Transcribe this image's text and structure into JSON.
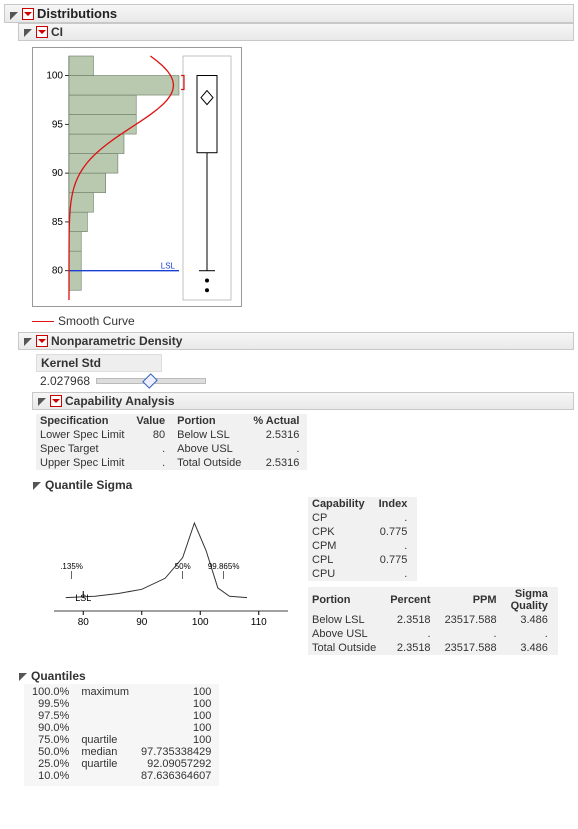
{
  "title": "Distributions",
  "section_ci": "CI",
  "legend_smooth": "Smooth Curve",
  "np_title": "Nonparametric Density",
  "kernel_label": "Kernel Std",
  "kernel_value": "2.027968",
  "cap_title": "Capability Analysis",
  "spec_headers": {
    "spec": "Specification",
    "value": "Value",
    "portion": "Portion",
    "actual": "% Actual"
  },
  "spec_rows": [
    {
      "spec": "Lower Spec Limit",
      "value": "80",
      "portion": "Below LSL",
      "actual": "2.5316"
    },
    {
      "spec": "Spec Target",
      "value": ".",
      "portion": "Above USL",
      "actual": "."
    },
    {
      "spec": "Upper Spec Limit",
      "value": ".",
      "portion": "Total Outside",
      "actual": "2.5316"
    }
  ],
  "qs_title": "Quantile Sigma",
  "cap_header": {
    "c": "Capability",
    "i": "Index"
  },
  "cap_rows": [
    {
      "c": "CP",
      "i": "."
    },
    {
      "c": "CPK",
      "i": "0.775"
    },
    {
      "c": "CPM",
      "i": "."
    },
    {
      "c": "CPL",
      "i": "0.775"
    },
    {
      "c": "CPU",
      "i": "."
    }
  ],
  "portion_header": {
    "p": "Portion",
    "pc": "Percent",
    "ppm": "PPM",
    "sq1": "Sigma",
    "sq2": "Quality"
  },
  "portion_rows": [
    {
      "p": "Below LSL",
      "pc": "2.3518",
      "ppm": "23517.588",
      "sq": "3.486"
    },
    {
      "p": "Above USL",
      "pc": ".",
      "ppm": ".",
      "sq": "."
    },
    {
      "p": "Total Outside",
      "pc": "2.3518",
      "ppm": "23517.588",
      "sq": "3.486"
    }
  ],
  "quant_title": "Quantiles",
  "quantiles": [
    {
      "p": "100.0%",
      "l": "maximum",
      "v": "100"
    },
    {
      "p": "99.5%",
      "l": "",
      "v": "100"
    },
    {
      "p": "97.5%",
      "l": "",
      "v": "100"
    },
    {
      "p": "90.0%",
      "l": "",
      "v": "100"
    },
    {
      "p": "75.0%",
      "l": "quartile",
      "v": "100"
    },
    {
      "p": "50.0%",
      "l": "median",
      "v": "97.735338429"
    },
    {
      "p": "25.0%",
      "l": "quartile",
      "v": "92.09057292"
    },
    {
      "p": "10.0%",
      "l": "",
      "v": "87.636364607"
    }
  ],
  "chart_data": {
    "type": "histogram+density+box",
    "y_axis_ticks": [
      80,
      85,
      90,
      95,
      100
    ],
    "histogram_bins": [
      {
        "low": 78,
        "high": 80,
        "count": 2
      },
      {
        "low": 80,
        "high": 82,
        "count": 2
      },
      {
        "low": 82,
        "high": 84,
        "count": 2
      },
      {
        "low": 84,
        "high": 86,
        "count": 3
      },
      {
        "low": 86,
        "high": 88,
        "count": 4
      },
      {
        "low": 88,
        "high": 90,
        "count": 6
      },
      {
        "low": 90,
        "high": 92,
        "count": 8
      },
      {
        "low": 92,
        "high": 94,
        "count": 9
      },
      {
        "low": 94,
        "high": 96,
        "count": 11
      },
      {
        "low": 96,
        "high": 98,
        "count": 11
      },
      {
        "low": 98,
        "high": 100,
        "count": 18
      },
      {
        "low": 100,
        "high": 102,
        "count": 4
      }
    ],
    "lsl": 80,
    "lsl_label": "LSL",
    "smooth_curve": {
      "peak_y": 99,
      "spread": 6
    },
    "boxplot": {
      "min": 80,
      "q1": 92.09,
      "median": 97.74,
      "q3": 100,
      "max": 100,
      "outliers": [
        78,
        79
      ]
    }
  },
  "qs_chart": {
    "type": "density+axis",
    "x_ticks": [
      80,
      90,
      100,
      110
    ],
    "labels": [
      {
        "x": 80,
        "text": "LSL"
      },
      {
        "x": 78,
        "text": ".135%"
      },
      {
        "x": 97,
        "text": "50%"
      },
      {
        "x": 104,
        "text": "99.865%"
      }
    ],
    "curve_x": [
      77,
      82,
      86,
      90,
      94,
      97,
      99,
      101,
      103,
      105,
      108
    ],
    "curve_y": [
      0.01,
      0.02,
      0.04,
      0.07,
      0.15,
      0.3,
      0.55,
      0.35,
      0.08,
      0.02,
      0.01
    ]
  }
}
